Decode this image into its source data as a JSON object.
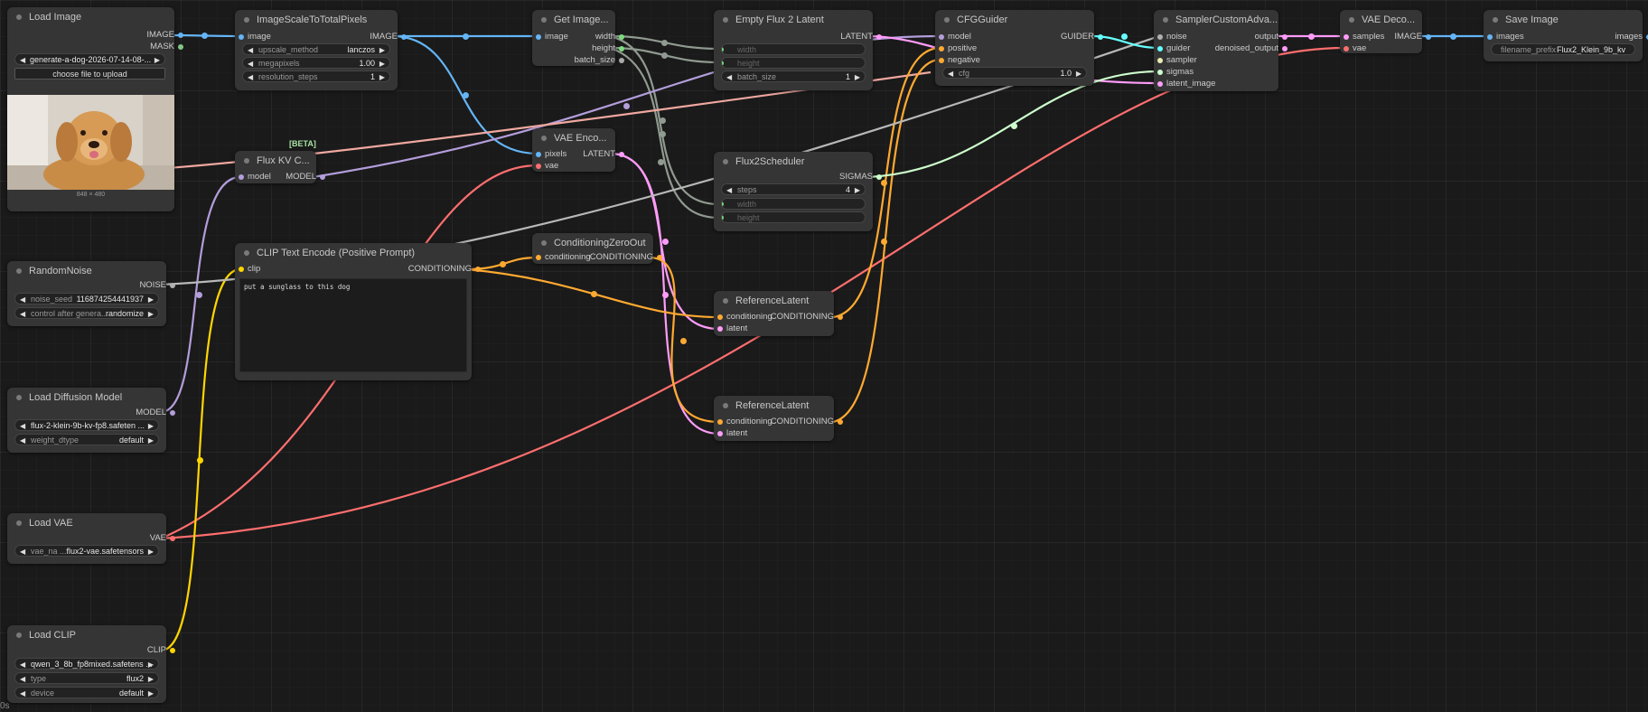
{
  "colors": {
    "image": "#64b5f6",
    "mask": "#81c784",
    "model": "#b39ddb",
    "latent": "#ff9cf9",
    "conditioning": "#ffa931",
    "vae": "#ff6e6e",
    "clip": "#ffd500",
    "int": "#7ddc7d",
    "noise": "#b0b0b0",
    "guider": "#66ffff",
    "sigmas": "#cdffcd",
    "sampler": "#ececb3"
  },
  "nodes": {
    "load_image": {
      "title": "Load Image",
      "out_image": "IMAGE",
      "out_mask": "MASK",
      "file": "generate-a-dog-2026-07-14-08-...",
      "upload_button": "choose file to upload",
      "size_caption": "848 × 480"
    },
    "image_scale": {
      "title": "ImageScaleToTotalPixels",
      "in_image": "image",
      "out_image": "IMAGE",
      "upscale_label": "upscale_method",
      "upscale_value": "lanczos",
      "mp_label": "megapixels",
      "mp_value": "1.00",
      "steps_label": "resolution_steps",
      "steps_value": "1"
    },
    "get_image": {
      "title": "Get Image...",
      "in_image": "image",
      "out_width": "width",
      "out_height": "height",
      "out_batch": "batch_size"
    },
    "empty_latent": {
      "title": "Empty Flux 2 Latent",
      "out_latent": "LATENT",
      "in_width": "width",
      "in_height": "height",
      "batch_label": "batch_size",
      "batch_value": "1"
    },
    "cfg_guider": {
      "title": "CFGGuider",
      "in_model": "model",
      "in_positive": "positive",
      "in_negative": "negative",
      "out_guider": "GUIDER",
      "cfg_label": "cfg",
      "cfg_value": "1.0"
    },
    "sampler": {
      "title": "SamplerCustomAdva...",
      "in_noise": "noise",
      "in_guider": "guider",
      "in_sampler": "sampler",
      "in_sigmas": "sigmas",
      "in_latent": "latent_image",
      "out_output": "output",
      "out_denoised": "denoised_output"
    },
    "vae_decode": {
      "title": "VAE Deco...",
      "in_samples": "samples",
      "in_vae": "vae",
      "out_image": "IMAGE"
    },
    "save_image": {
      "title": "Save Image",
      "in_images": "images",
      "out_images": "images",
      "prefix_label": "filename_prefix",
      "prefix_value": "Flux2_Klein_9b_kv"
    },
    "flux_kv": {
      "badge": "[BETA]",
      "title": "Flux KV C...",
      "in_model": "model",
      "out_model": "MODEL"
    },
    "vae_encode": {
      "title": "VAE Enco...",
      "in_pixels": "pixels",
      "in_vae": "vae",
      "out_latent": "LATENT"
    },
    "flux2_scheduler": {
      "title": "Flux2Scheduler",
      "out_sigmas": "SIGMAS",
      "steps_label": "steps",
      "steps_value": "4",
      "in_width": "width",
      "in_height": "height"
    },
    "random_noise": {
      "title": "RandomNoise",
      "out_noise": "NOISE",
      "seed_label": "noise_seed",
      "seed_value": "116874254441937",
      "control_label": "control after genera...",
      "control_value": "randomize"
    },
    "clip_text": {
      "title": "CLIP Text Encode (Positive Prompt)",
      "in_clip": "clip",
      "out_cond": "CONDITIONING",
      "prompt": "put a sunglass to this dog"
    },
    "cond_zero": {
      "title": "ConditioningZeroOut",
      "in_cond": "conditioning",
      "out_cond": "CONDITIONING"
    },
    "ref_latent_1": {
      "title": "ReferenceLatent",
      "in_cond": "conditioning",
      "in_latent": "latent",
      "out_cond": "CONDITIONING"
    },
    "ref_latent_2": {
      "title": "ReferenceLatent",
      "in_cond": "conditioning",
      "in_latent": "latent",
      "out_cond": "CONDITIONING"
    },
    "load_diffusion": {
      "title": "Load Diffusion Model",
      "out_model": "MODEL",
      "unet_value": "flux-2-klein-9b-kv-fp8.safeten ...",
      "dtype_label": "weight_dtype",
      "dtype_value": "default"
    },
    "load_vae": {
      "title": "Load VAE",
      "out_vae": "VAE",
      "vae_label": "vae_na ...",
      "vae_value": "flux2-vae.safetensors"
    },
    "load_clip": {
      "title": "Load CLIP",
      "out_clip": "CLIP",
      "clip_value": "qwen_3_8b_fp8mixed.safetens ...",
      "type_label": "type",
      "type_value": "flux2",
      "device_label": "device",
      "device_value": "default"
    }
  },
  "status": {
    "elapsed": "0s"
  }
}
